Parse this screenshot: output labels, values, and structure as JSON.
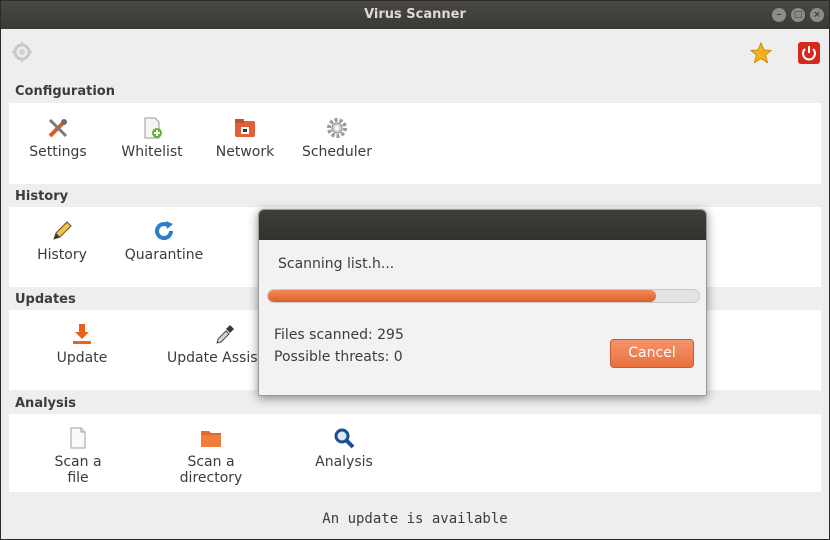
{
  "window": {
    "title": "Virus Scanner"
  },
  "toolbar": {
    "left_icon": "app-logo-icon",
    "star_icon": "star-icon",
    "power_icon": "power-icon"
  },
  "sections": {
    "configuration": {
      "title": "Configuration",
      "items": [
        {
          "label": "Settings",
          "icon": "tools-icon"
        },
        {
          "label": "Whitelist",
          "icon": "document-add-icon"
        },
        {
          "label": "Network",
          "icon": "network-icon"
        },
        {
          "label": "Scheduler",
          "icon": "gear-icon"
        }
      ]
    },
    "history": {
      "title": "History",
      "items": [
        {
          "label": "History",
          "icon": "pencil-icon"
        },
        {
          "label": "Quarantine",
          "icon": "refresh-icon"
        }
      ]
    },
    "updates": {
      "title": "Updates",
      "items": [
        {
          "label": "Update",
          "icon": "download-icon"
        },
        {
          "label": "Update Assistant",
          "icon": "dropper-icon"
        }
      ]
    },
    "analysis": {
      "title": "Analysis",
      "items": [
        {
          "label": "Scan a file",
          "icon": "file-icon"
        },
        {
          "label": "Scan a directory",
          "icon": "folder-icon"
        },
        {
          "label": "Analysis",
          "icon": "magnifier-icon"
        }
      ]
    }
  },
  "status": {
    "text": "An update is available"
  },
  "dialog": {
    "message": "Scanning list.h...",
    "progress": 0.9,
    "files_scanned": "Files scanned: 295",
    "possible_threats": "Possible threats: 0",
    "cancel_label": "Cancel"
  },
  "colors": {
    "accent": "#e9703f",
    "titlebar": "#3b3935",
    "close": "#d7281d"
  }
}
